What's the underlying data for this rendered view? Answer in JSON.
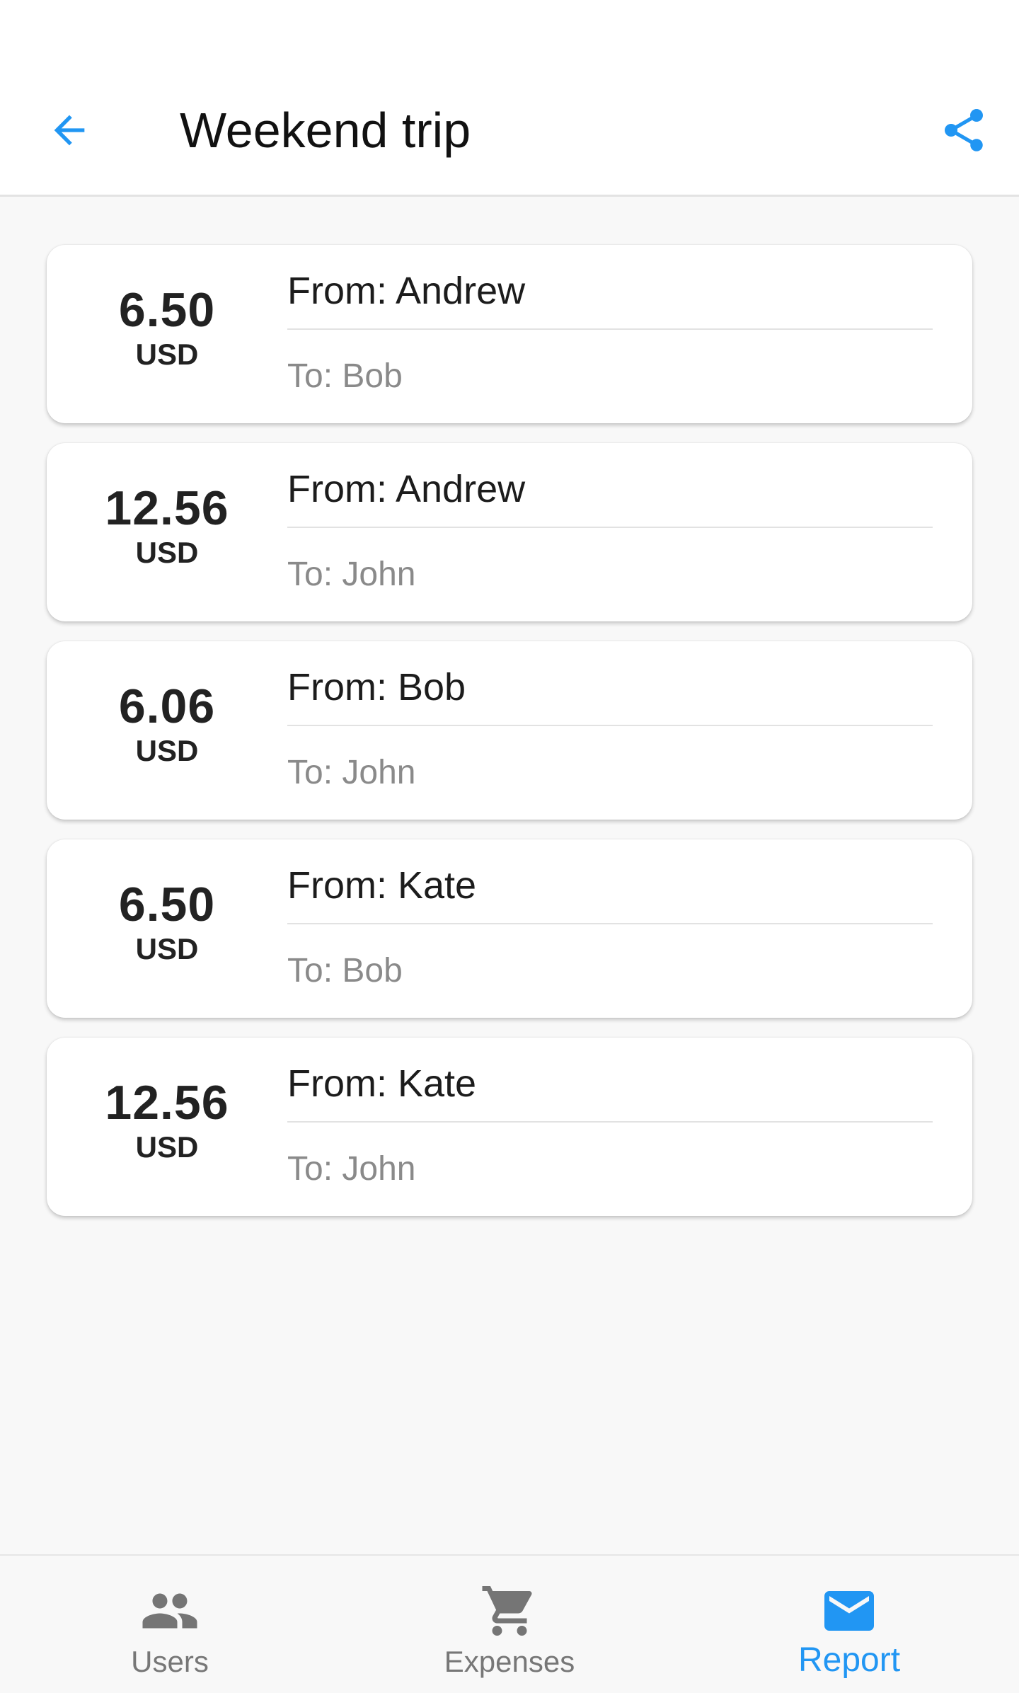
{
  "header": {
    "title": "Weekend trip",
    "back_icon": "arrow-left-icon",
    "share_icon": "share-icon"
  },
  "colors": {
    "accent": "#2196f3",
    "background": "#f8f8f8",
    "card": "#ffffff",
    "secondary_text": "#8a8a8a",
    "nav_inactive": "#777777"
  },
  "transfers": [
    {
      "amount": "6.50",
      "currency": "USD",
      "from": "From: Andrew",
      "to": "To: Bob"
    },
    {
      "amount": "12.56",
      "currency": "USD",
      "from": "From: Andrew",
      "to": "To: John"
    },
    {
      "amount": "6.06",
      "currency": "USD",
      "from": "From: Bob",
      "to": "To: John"
    },
    {
      "amount": "6.50",
      "currency": "USD",
      "from": "From: Kate",
      "to": "To: Bob"
    },
    {
      "amount": "12.56",
      "currency": "USD",
      "from": "From: Kate",
      "to": "To: John"
    }
  ],
  "bottom_nav": {
    "items": [
      {
        "label": "Users",
        "icon": "users-icon",
        "active": false
      },
      {
        "label": "Expenses",
        "icon": "cart-icon",
        "active": false
      },
      {
        "label": "Report",
        "icon": "mail-icon",
        "active": true
      }
    ]
  }
}
